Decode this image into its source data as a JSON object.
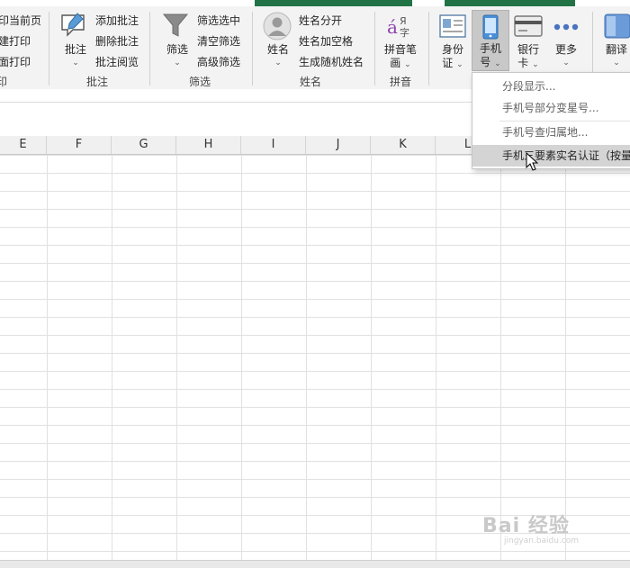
{
  "ribbon": {
    "print_group": {
      "items": [
        "印当前页",
        "建打印",
        "面打印"
      ],
      "label": "印"
    },
    "comment_group": {
      "big_button": "批注",
      "items": [
        "添加批注",
        "删除批注",
        "批注阅览"
      ],
      "label": "批注"
    },
    "filter_group": {
      "big_button": "筛选",
      "items": [
        "筛选选中",
        "清空筛选",
        "高级筛选"
      ],
      "label": "筛选"
    },
    "name_group": {
      "big_button": "姓名",
      "items": [
        "姓名分开",
        "姓名加空格",
        "生成随机姓名"
      ],
      "label": "姓名"
    },
    "pinyin_group": {
      "big_button_line1": "拼音笔",
      "big_button_line2": "画",
      "label": "拼音"
    },
    "id_card": {
      "line1": "身份",
      "line2": "证"
    },
    "phone": {
      "line1": "手机",
      "line2": "号"
    },
    "bank_card": {
      "line1": "银行",
      "line2": "卡"
    },
    "more": {
      "label": "更多"
    },
    "translate": {
      "label": "翻译"
    }
  },
  "columns": [
    "E",
    "F",
    "G",
    "H",
    "I",
    "J",
    "K",
    "L"
  ],
  "dropdown": {
    "items": [
      "分段显示...",
      "手机号部分变星号...",
      "手机号查归属地...",
      "手机三要素实名认证（按量"
    ]
  },
  "watermark": {
    "main": "Bai 经验",
    "sub": "jingyan.baidu.com"
  },
  "colors": {
    "accent": "#217346",
    "highlight": "#d4d4d4"
  }
}
